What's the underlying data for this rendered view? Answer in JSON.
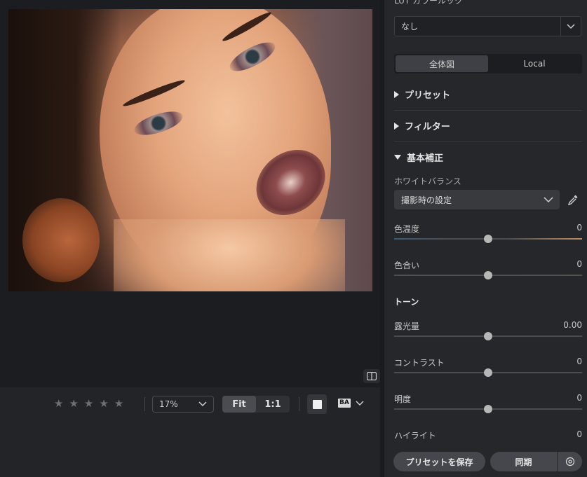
{
  "toolbar": {
    "rating_stars": [
      "★",
      "★",
      "★",
      "★",
      "★"
    ],
    "zoom_value": "17%",
    "fit_label": "Fit",
    "one_to_one_label": "1:1",
    "before_after_label": "BA"
  },
  "panel": {
    "lut_label_partial": "LUT カラールック",
    "lut_value": "なし",
    "scope_tabs": [
      "全体図",
      "Local"
    ],
    "sections": {
      "preset": "プリセット",
      "filter": "フィルター",
      "basic": "基本補正"
    },
    "white_balance": {
      "label": "ホワイトバランス",
      "value": "撮影時の設定"
    },
    "sliders": {
      "temperature": {
        "label": "色温度",
        "value": "0"
      },
      "tint": {
        "label": "色合い",
        "value": "0"
      },
      "exposure": {
        "label": "露光量",
        "value": "0.00"
      },
      "contrast": {
        "label": "コントラスト",
        "value": "0"
      },
      "brightness": {
        "label": "明度",
        "value": "0"
      },
      "highlights": {
        "label": "ハイライト",
        "value": "0"
      }
    },
    "tone_title": "トーン",
    "footer": {
      "save_preset": "プリセットを保存",
      "sync": "同期"
    }
  },
  "colors": {
    "accent_warm": "#c28a5c",
    "panel_bg": "#25272b",
    "canvas_bg": "#1c1d20"
  }
}
